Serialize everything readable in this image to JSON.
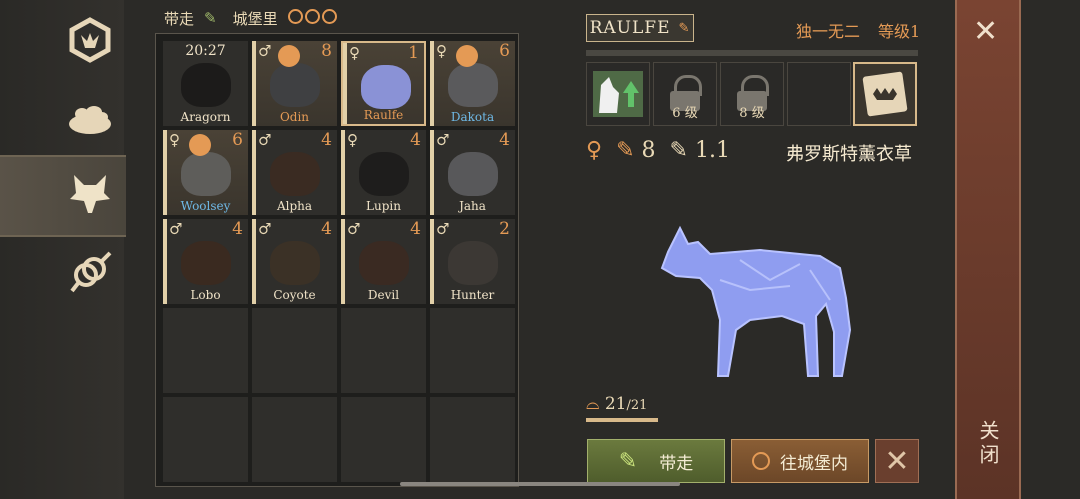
{
  "header": {
    "take_label": "带走",
    "castle_label": "城堡里"
  },
  "grid": {
    "cells": [
      {
        "name": "Aragorn",
        "time": "20:27",
        "num": "",
        "sex": "",
        "name_color": "white",
        "head": "#1c1b1a"
      },
      {
        "name": "Odin",
        "time": "",
        "num": "8",
        "sex": "♂",
        "name_color": "gold",
        "head": "#3f4042"
      },
      {
        "name": "Raulfe",
        "time": "",
        "num": "1",
        "sex": "♀",
        "name_color": "gold",
        "head": "#8a92d6"
      },
      {
        "name": "Dakota",
        "time": "",
        "num": "6",
        "sex": "♀",
        "name_color": "blue",
        "head": "#5a5a5c"
      },
      {
        "name": "Woolsey",
        "time": "",
        "num": "6",
        "sex": "♀",
        "name_color": "blue",
        "head": "#5e5d5a"
      },
      {
        "name": "Alpha",
        "time": "",
        "num": "4",
        "sex": "♂",
        "name_color": "white",
        "head": "#3a2b22"
      },
      {
        "name": "Lupin",
        "time": "",
        "num": "4",
        "sex": "♀",
        "name_color": "white",
        "head": "#1e1d1c"
      },
      {
        "name": "Jaha",
        "time": "",
        "num": "4",
        "sex": "♂",
        "name_color": "white",
        "head": "#58585a"
      },
      {
        "name": "Lobo",
        "time": "",
        "num": "4",
        "sex": "♂",
        "name_color": "white",
        "head": "#3a2a20"
      },
      {
        "name": "Coyote",
        "time": "",
        "num": "4",
        "sex": "♂",
        "name_color": "white",
        "head": "#3b3126"
      },
      {
        "name": "Devil",
        "time": "",
        "num": "4",
        "sex": "♂",
        "name_color": "white",
        "head": "#3a2a22"
      },
      {
        "name": "Hunter",
        "time": "",
        "num": "2",
        "sex": "♂",
        "name_color": "white",
        "head": "#3c3834"
      }
    ]
  },
  "detail": {
    "name": "RAULFE",
    "rarity": "独一无二",
    "level": "等级1",
    "slot_lock1": "6 级",
    "slot_lock2": "8 级",
    "stat_attack": "8",
    "stat_speed": "1.1",
    "nickname": "弗罗斯特薰衣草",
    "teeth": "21",
    "teeth_max": "/21"
  },
  "buttons": {
    "take": "带走",
    "to_castle": "往城堡内",
    "close": "关闭"
  },
  "colors": {
    "accent": "#e49a55",
    "take_btn": "#5f6e35",
    "castle_btn": "#7b5230",
    "close_col": "#6b3b2c",
    "wolf": "#8f9df0"
  }
}
